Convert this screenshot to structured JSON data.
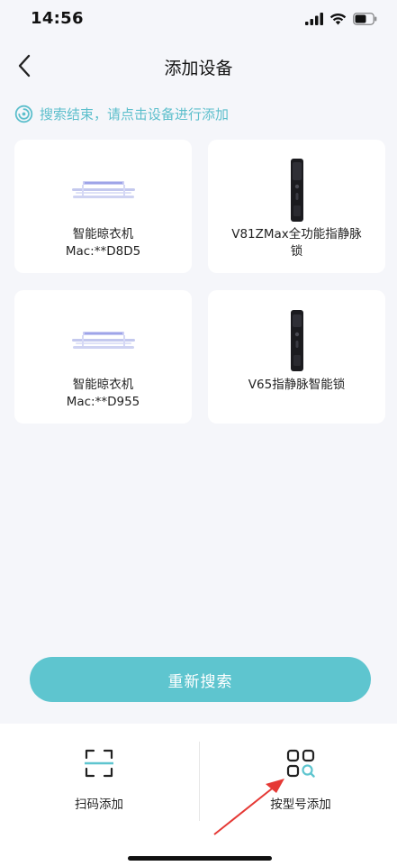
{
  "status_bar": {
    "time": "14:56"
  },
  "nav": {
    "title": "添加设备"
  },
  "search_status": {
    "text": "搜索结束，请点击设备进行添加"
  },
  "devices": [
    {
      "name": "智能晾衣机",
      "mac": "Mac:**D8D5",
      "image": "clothes-drying-rack"
    },
    {
      "name": "V81ZMax全功能指静脉",
      "name2": "锁",
      "image": "smart-lock-tall"
    },
    {
      "name": "智能晾衣机",
      "mac": "Mac:**D955",
      "image": "clothes-drying-rack"
    },
    {
      "name": "V65指静脉智能锁",
      "image": "smart-lock"
    }
  ],
  "rescan_button": {
    "label": "重新搜索"
  },
  "bottom_actions": {
    "scan": {
      "label": "扫码添加",
      "icon": "scan-icon"
    },
    "model": {
      "label": "按型号添加",
      "icon": "grid-search-icon"
    }
  },
  "colors": {
    "accent": "#5ec5cf",
    "background": "#f5f6fa",
    "annotation": "#e53935"
  }
}
